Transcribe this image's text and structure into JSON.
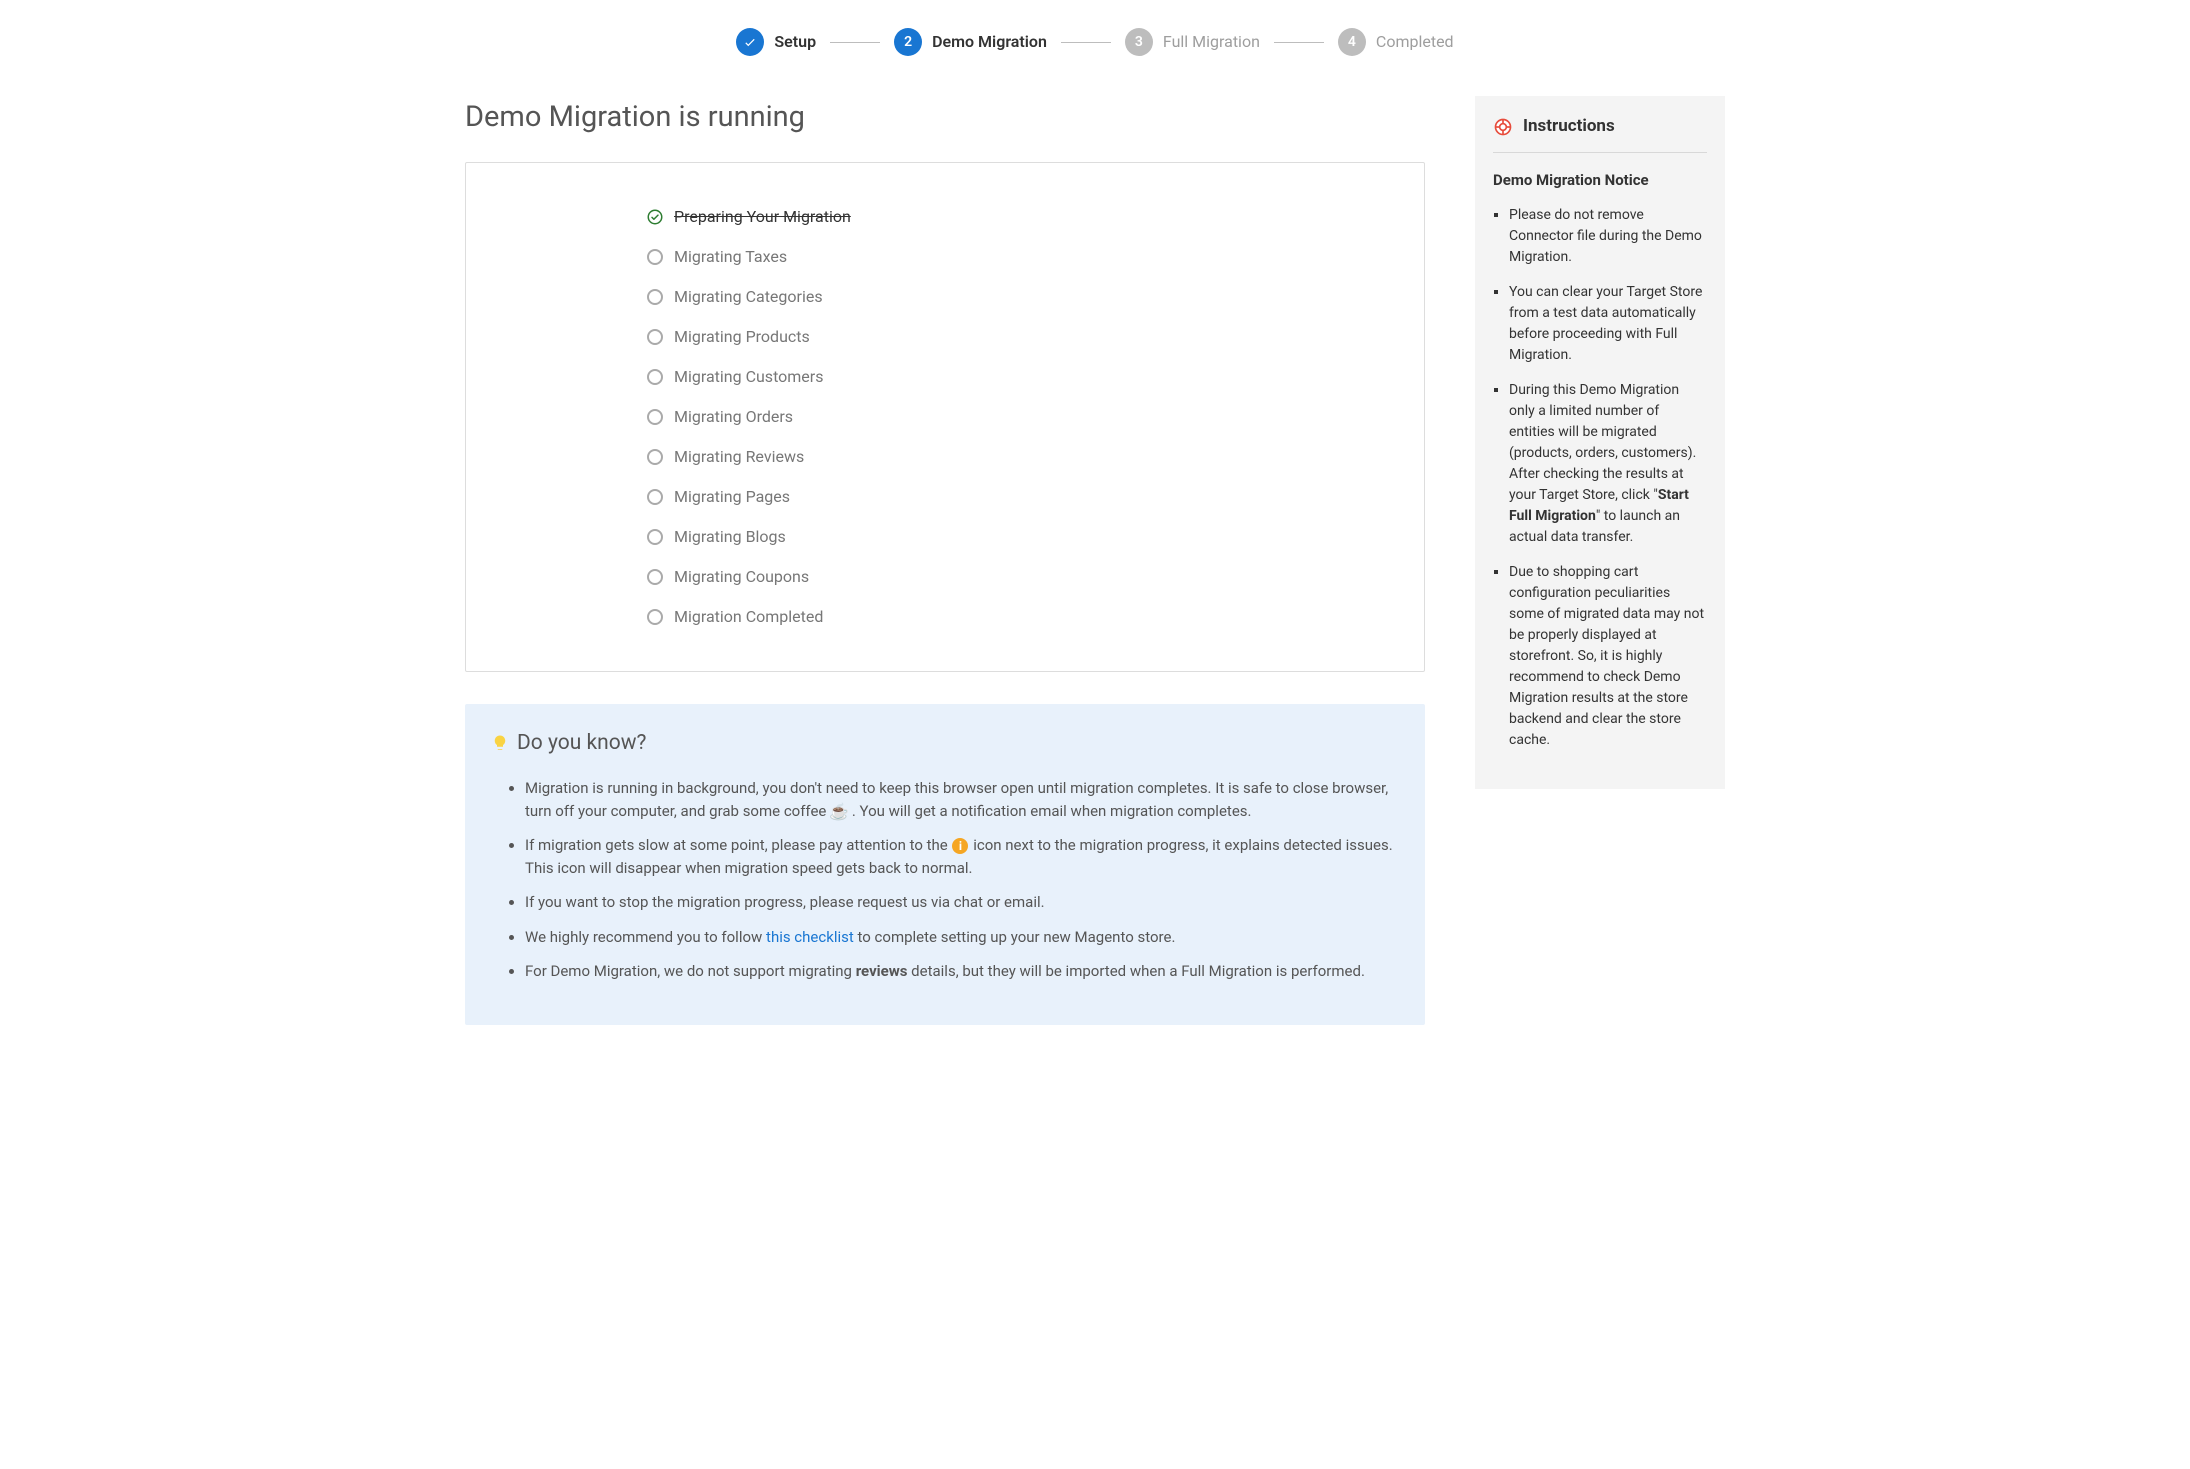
{
  "stepper": {
    "steps": [
      {
        "label": "Setup",
        "state": "done",
        "indicator": "check"
      },
      {
        "label": "Demo Migration",
        "state": "active",
        "indicator": "2"
      },
      {
        "label": "Full Migration",
        "state": "pending",
        "indicator": "3"
      },
      {
        "label": "Completed",
        "state": "pending",
        "indicator": "4"
      }
    ]
  },
  "page": {
    "title": "Demo Migration is running"
  },
  "progress": {
    "items": [
      {
        "label": "Preparing Your Migration",
        "status": "completed"
      },
      {
        "label": "Migrating Taxes",
        "status": "pending"
      },
      {
        "label": "Migrating Categories",
        "status": "pending"
      },
      {
        "label": "Migrating Products",
        "status": "pending"
      },
      {
        "label": "Migrating Customers",
        "status": "pending"
      },
      {
        "label": "Migrating Orders",
        "status": "pending"
      },
      {
        "label": "Migrating Reviews",
        "status": "pending"
      },
      {
        "label": "Migrating Pages",
        "status": "pending"
      },
      {
        "label": "Migrating Blogs",
        "status": "pending"
      },
      {
        "label": "Migrating Coupons",
        "status": "pending"
      },
      {
        "label": "Migration Completed",
        "status": "pending"
      }
    ]
  },
  "infobox": {
    "title": "Do you know?",
    "tips": {
      "t1a": "Migration is running in background, you don't need to keep this browser open until migration completes. It is safe to close browser, turn off your computer, and grab some coffee",
      "t1b": ". You will get a notification email when migration completes.",
      "t2a": "If migration gets slow at some point, please pay attention to the ",
      "t2b": " icon next to the migration progress, it explains detected issues. This icon will disappear when migration speed gets back to normal.",
      "t3": "If you want to stop the migration progress, please request us via chat or email.",
      "t4a": "We highly recommend you to follow ",
      "t4link": "this checklist",
      "t4b": " to complete setting up your new Magento store.",
      "t5a": "For Demo Migration, we do not support migrating ",
      "t5strong": "reviews",
      "t5b": " details, but they will be imported when a Full Migration is performed."
    }
  },
  "sidebar": {
    "title": "Instructions",
    "notice_title": "Demo Migration Notice",
    "notices": {
      "n1": "Please do not remove Connector file during the Demo Migration.",
      "n2": "You can clear your Target Store from a test data automatically before proceeding with Full Migration.",
      "n3a": "During this Demo Migration only a limited number of entities will be migrated (products, orders, customers). After checking the results at your Target Store, click \"",
      "n3strong": "Start Full Migration",
      "n3b": "\" to launch an actual data transfer.",
      "n4": "Due to shopping cart configuration peculiarities some of migrated data may not be properly displayed at storefront. So, it is highly recommend to check Demo Migration results at the store backend and clear the store cache."
    }
  }
}
